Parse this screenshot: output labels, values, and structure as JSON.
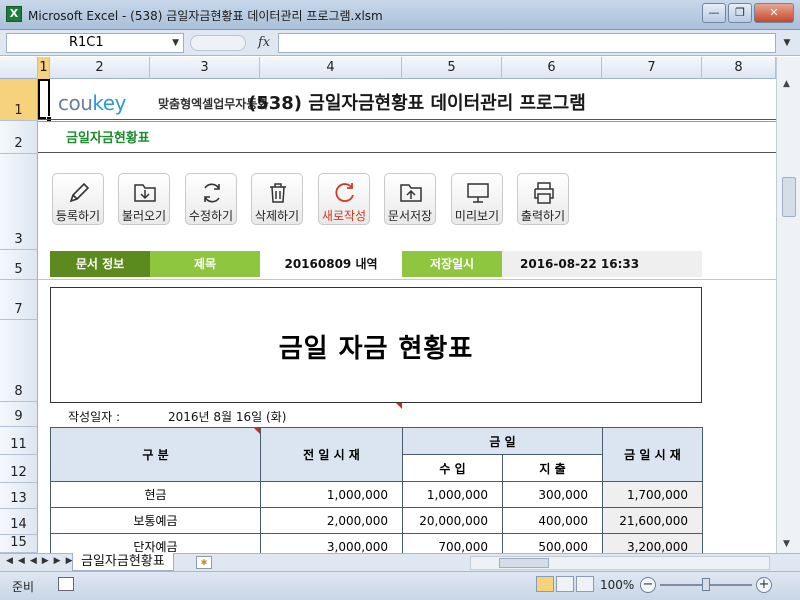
{
  "window": {
    "title": "Microsoft Excel - (538) 금일자금현황표 데이터관리 프로그램.xlsm",
    "app_icon_letter": "X"
  },
  "formula_bar": {
    "name_box": "R1C1",
    "fx": "fx",
    "value": ""
  },
  "columns": [
    "1",
    "2",
    "3",
    "4",
    "5",
    "6",
    "7",
    "8"
  ],
  "rows": [
    "1",
    "2",
    "3",
    "5",
    "7",
    "8",
    "9",
    "11",
    "12",
    "13",
    "14",
    "15"
  ],
  "header": {
    "brand_cou": "cou",
    "brand_key": "key",
    "brand_tagline": "맞춤형엑셀업무자동화",
    "program_title": "(538) 금일자금현황표 데이터관리 프로그램",
    "subtitle": "금일자금현황표"
  },
  "toolbar": [
    {
      "label": "등록하기",
      "icon": "pencil-icon"
    },
    {
      "label": "불러오기",
      "icon": "folder-download-icon"
    },
    {
      "label": "수정하기",
      "icon": "refresh-icon"
    },
    {
      "label": "삭제하기",
      "icon": "trash-icon"
    },
    {
      "label": "새로작성",
      "icon": "new-circle-icon"
    },
    {
      "label": "문서저장",
      "icon": "folder-upload-icon"
    },
    {
      "label": "미리보기",
      "icon": "monitor-icon"
    },
    {
      "label": "출력하기",
      "icon": "printer-icon"
    }
  ],
  "doc_info": {
    "label": "문서 정보",
    "title_label": "제목",
    "title_value": "20160809 내역",
    "saved_label": "저장일시",
    "saved_value": "2016-08-22 16:33"
  },
  "report": {
    "title": "금일 자금 현황표",
    "date_label": "작성일자 :",
    "date_value": "2016년 8월 16일 (화)"
  },
  "table": {
    "h_category": "구      분",
    "h_prev": "전 일 시 재",
    "h_today": "금          일",
    "h_income": "수    입",
    "h_expense": "지    출",
    "h_current": "금 일 시 재",
    "rows": [
      {
        "name": "현금",
        "prev": "1,000,000",
        "income": "1,000,000",
        "expense": "300,000",
        "current": "1,700,000"
      },
      {
        "name": "보통예금",
        "prev": "2,000,000",
        "income": "20,000,000",
        "expense": "400,000",
        "current": "21,600,000"
      },
      {
        "name": "단자예금",
        "prev": "3,000,000",
        "income": "700,000",
        "expense": "500,000",
        "current": "3,200,000"
      }
    ]
  },
  "sheet_tabs": {
    "active": "금일자금현황표"
  },
  "status": {
    "ready": "준비",
    "zoom": "100%"
  },
  "colors": {
    "accent_dark": "#5c8a1f",
    "accent_light": "#8ec63f",
    "table_header": "#dbe5f1",
    "new_button": "#d03a22"
  }
}
